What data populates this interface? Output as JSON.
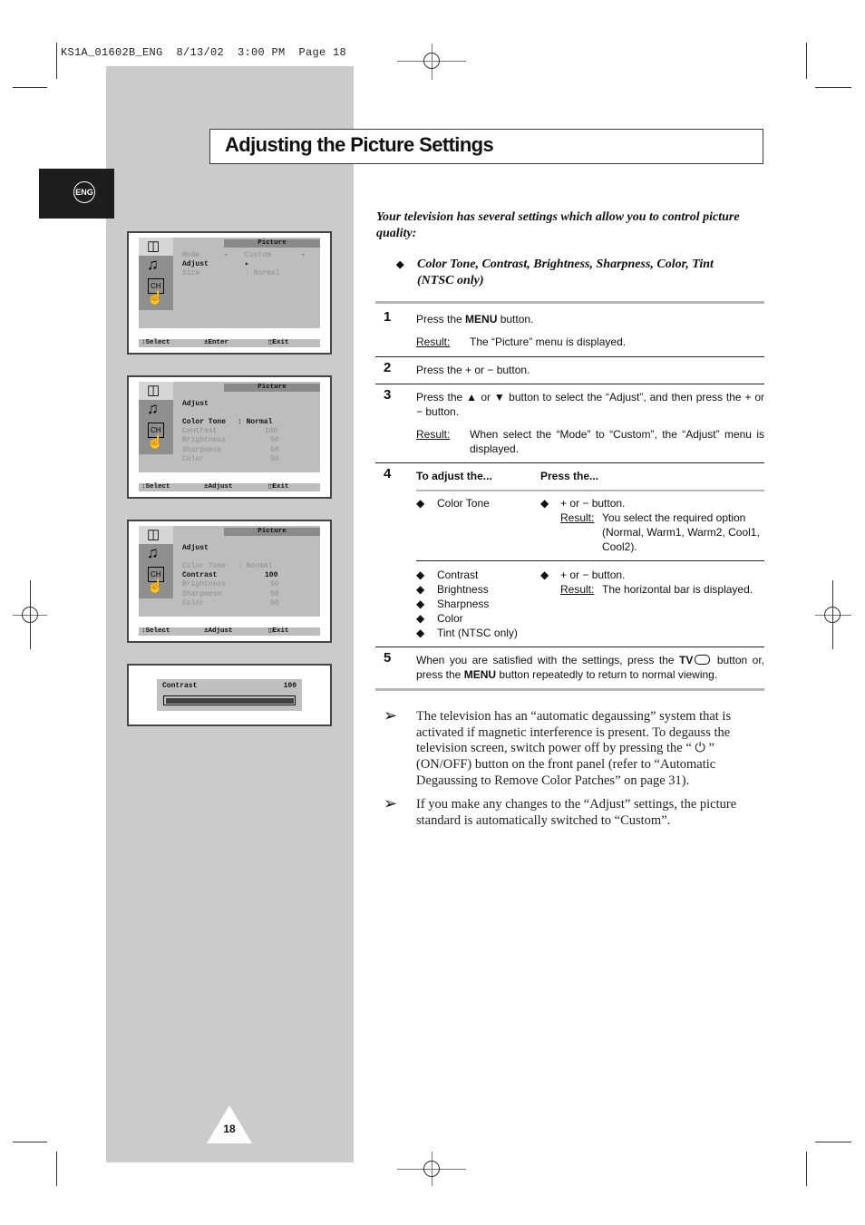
{
  "slug": "KS1A_01602B_ENG  8/13/02  3:00 PM  Page 18",
  "language_tab": "ENG",
  "title": "Adjusting the Picture Settings",
  "intro": "Your television has several settings which allow you to control picture quality:",
  "intro_bullet": "Color Tone, Contrast, Brightness, Sharpness, Color, Tint (NTSC only)",
  "result_label": "Result:",
  "steps": {
    "s1": {
      "num": "1",
      "pre": "Press the ",
      "bold": "MENU",
      "post": " button.",
      "result": "The “Picture” menu is displayed."
    },
    "s2": {
      "num": "2",
      "text": "Press the + or − button."
    },
    "s3": {
      "num": "3",
      "text": "Press the ▲ or ▼ button to select the “Adjust”, and then press the + or − button.",
      "result": "When select the “Mode” to “Custom”, the “Adjust” menu is displayed."
    },
    "s4": {
      "num": "4",
      "col1_header": "To adjust the...",
      "col2_header": "Press the...",
      "row1": {
        "items": [
          "Color Tone"
        ],
        "press": "+ or − button.",
        "result": "You select the required option (Normal, Warm1, Warm2, Cool1, Cool2)."
      },
      "row2": {
        "items": [
          "Contrast",
          "Brightness",
          "Sharpness",
          "Color",
          "Tint (NTSC only)"
        ],
        "press": "+ or − button.",
        "result": "The horizontal bar is displayed."
      }
    },
    "s5": {
      "num": "5",
      "pre": "When you are satisfied with the settings, press the ",
      "bold1": "TV",
      "mid": " button or, press the ",
      "bold2": "MENU",
      "post": " button repeatedly to return to normal viewing."
    }
  },
  "notes": [
    "The television has an “automatic degaussing” system that is activated if magnetic interference is present. To degauss the television screen, switch power off by pressing the “ ⏻ ” (ON/OFF) button on the front panel (refer to “Automatic Degaussing to Remove Color Patches” on page 31).",
    "If you make any changes to the “Adjust” settings, the picture standard is automatically switched to “Custom”."
  ],
  "osd": {
    "header": "Picture",
    "screen1": {
      "rows": [
        {
          "label": "Mode",
          "value": "◂    Custom       ▸"
        },
        {
          "label": "Adjust",
          "value": "▸"
        },
        {
          "label": "Size",
          "value": ": Normal"
        }
      ],
      "footer": [
        "↕Select",
        "±Enter",
        "Exit"
      ]
    },
    "screen2": {
      "title": "Adjust",
      "rows": [
        {
          "label": "Color Tone",
          "value": ": Normal"
        },
        {
          "label": "Contrast",
          "value": "100"
        },
        {
          "label": "Brightness",
          "value": "50"
        },
        {
          "label": "Sharpness",
          "value": "50"
        },
        {
          "label": "Color",
          "value": "50"
        }
      ],
      "footer": [
        "↕Select",
        "±Adjust",
        "Exit"
      ]
    },
    "screen3": {
      "title": "Adjust",
      "rows": [
        {
          "label": "Color Tone",
          "value": ": Normal"
        },
        {
          "label": "Contrast",
          "value": "100"
        },
        {
          "label": "Brightness",
          "value": "50"
        },
        {
          "label": "Sharpness",
          "value": "50"
        },
        {
          "label": "Color",
          "value": "50"
        }
      ],
      "footer": [
        "↕Select",
        "±Adjust",
        "Exit"
      ]
    },
    "bar": {
      "label": "Contrast",
      "value": "100",
      "fill_percent": 100
    }
  },
  "page_number": "18"
}
